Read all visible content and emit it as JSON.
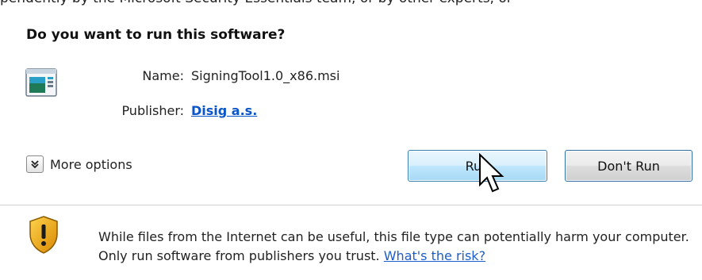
{
  "dialog": {
    "top_cut_text": "pendently by the Microsoft Security Essentials team, or by other experts, or",
    "title": "Do you want to run this software?",
    "file_icon": "msi-installer-icon",
    "name_label": "Name:",
    "name_value": "SigningTool1.0_x86.msi",
    "publisher_label": "Publisher:",
    "publisher_value": "Disig a.s.",
    "more_options_label": "More options",
    "more_options_icon": "double-chevron-down-icon",
    "run_label": "Run",
    "dont_run_label": "Don't Run",
    "cursor_icon": "mouse-pointer-icon",
    "warning_icon": "shield-warning-icon",
    "warning_text": "While files from the Internet can be useful, this file type can potentially harm your computer. Only run software from publishers you trust.",
    "risk_link": "What's the risk?"
  },
  "colors": {
    "link": "#0a55c8",
    "run_button_border": "#3c7fb1",
    "shield": "#e8a317"
  }
}
